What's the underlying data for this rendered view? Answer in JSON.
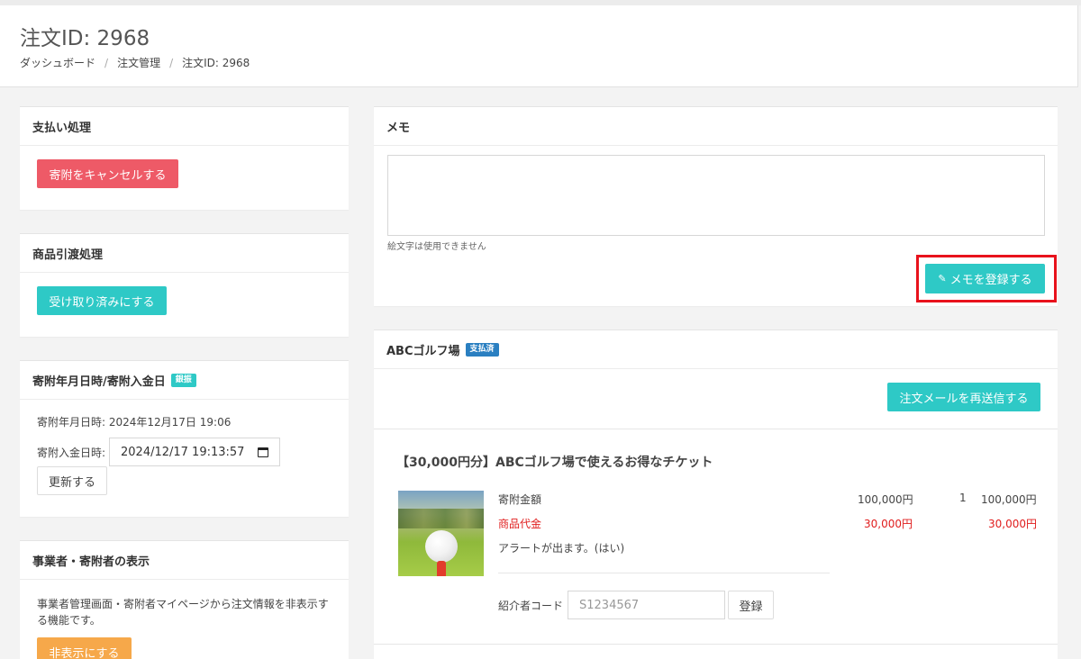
{
  "header": {
    "title": "注文ID: 2968",
    "breadcrumb": [
      "ダッシュボード",
      "注文管理",
      "注文ID: 2968"
    ]
  },
  "payment": {
    "title": "支払い処理",
    "cancel_button": "寄附をキャンセルする"
  },
  "delivery": {
    "title": "商品引渡処理",
    "received_button": "受け取り済みにする"
  },
  "dates": {
    "title": "寄附年月日時/寄附入金日",
    "badge": "銀振",
    "donation_datetime": "寄附年月日時: 2024年12月17日 19:06",
    "payment_label": "寄附入金日時:",
    "payment_value": "2024/12/17 19:13:57",
    "update_button": "更新する"
  },
  "visibility": {
    "title": "事業者・寄附者の表示",
    "description": "事業者管理画面・寄附者マイページから注文情報を非表示する機能です。",
    "hide_button": "非表示にする"
  },
  "memo": {
    "title": "メモ",
    "value": "",
    "note": "絵文字は使用できません",
    "save_button": "メモを登録する"
  },
  "shop": {
    "name": "ABCゴルフ場",
    "status_badge": "支払済",
    "resend_button": "注文メールを再送信する",
    "product_title": "【30,000円分】ABCゴルフ場で使えるお得なチケット",
    "rows": [
      {
        "label": "寄附金額",
        "unit_price": "100,000円",
        "qty": "1",
        "total": "100,000円"
      },
      {
        "label": "商品代金",
        "unit_price": "30,000円",
        "qty": "",
        "total": "30,000円"
      }
    ],
    "alert_text": "アラートが出ます。(はい)",
    "referrer_label": "紹介者コード",
    "referrer_placeholder": "S1234567",
    "register_button": "登録"
  },
  "colors": {
    "danger": "#ee5a67",
    "teal": "#2ec9c6",
    "warning": "#f6a84a",
    "info": "#2a7fc1",
    "highlight": "#e8121c"
  }
}
